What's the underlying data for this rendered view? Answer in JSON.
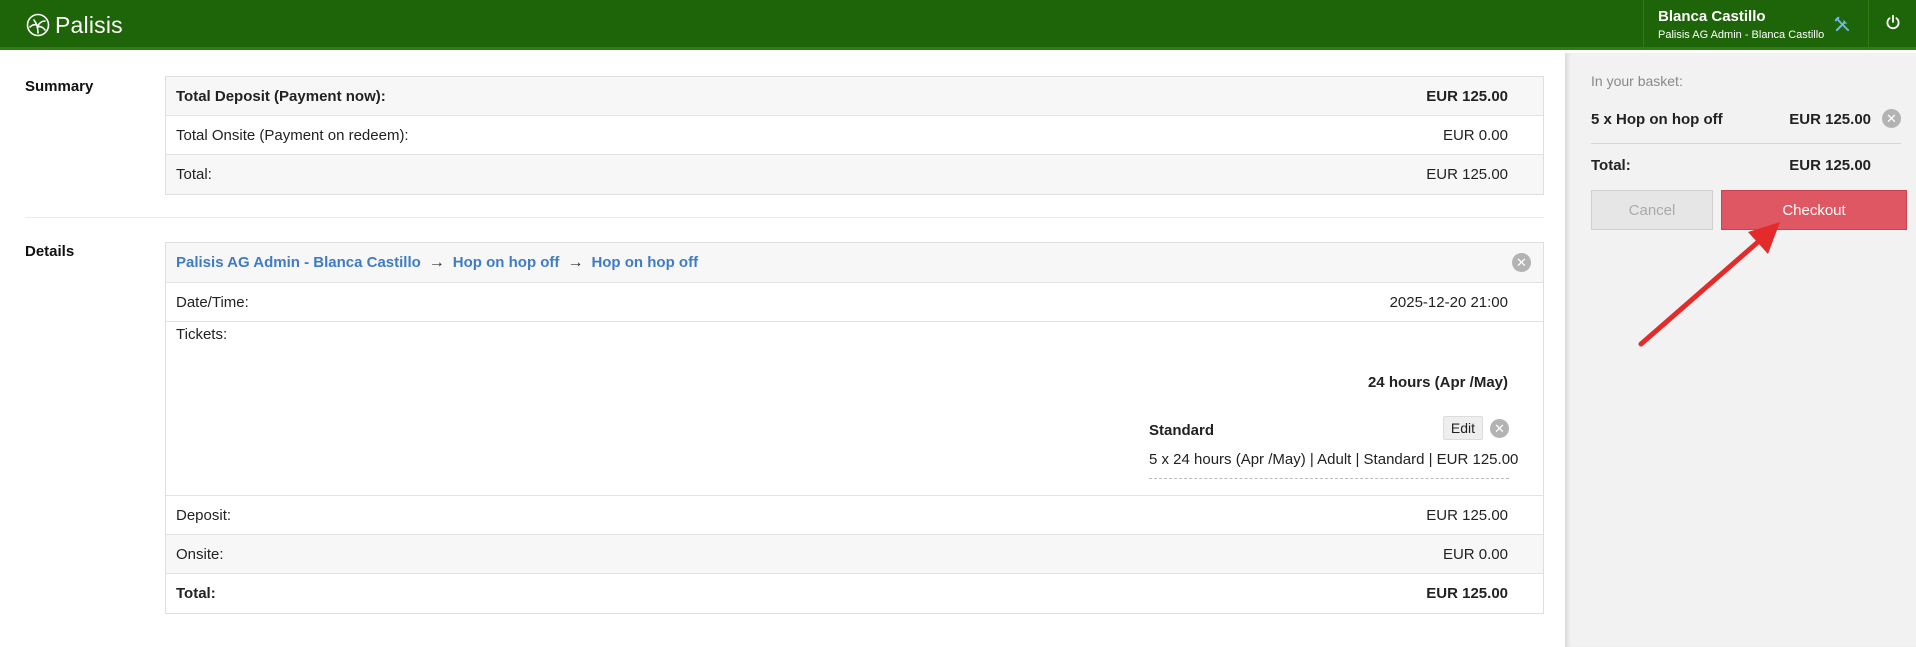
{
  "header": {
    "logo_text": "Palisis",
    "user_name": "Blanca Castillo",
    "user_org": "Palisis AG Admin - Blanca Castillo",
    "tools_icon": "tools-icon",
    "power_icon": "power-icon",
    "bar_color": "#1e6408"
  },
  "summary": {
    "label": "Summary",
    "rows": [
      {
        "label": "Total Deposit (Payment now):",
        "value": "EUR 125.00"
      },
      {
        "label": "Total Onsite (Payment on redeem):",
        "value": "EUR 0.00"
      },
      {
        "label": "Total:",
        "value": "EUR 125.00"
      }
    ]
  },
  "details": {
    "label": "Details",
    "breadcrumb": [
      "Palisis AG Admin - Blanca Castillo",
      "Hop on hop off",
      "Hop on hop off"
    ],
    "arrow": "→",
    "datetime_label": "Date/Time:",
    "datetime_value": "2025-12-20 21:00",
    "tickets_label": "Tickets:",
    "ticket_group": "24 hours (Apr /May)",
    "ticket_title": "Standard",
    "edit_label": "Edit",
    "ticket_desc": "5 x 24 hours (Apr /May) | Adult | Standard | EUR 125.00",
    "deposit_label": "Deposit:",
    "deposit_value": "EUR 125.00",
    "onsite_label": "Onsite:",
    "onsite_value": "EUR 0.00",
    "total_label": "Total:",
    "total_value": "EUR 125.00"
  },
  "basket": {
    "title": "In your basket:",
    "item_name": "5 x Hop on hop off",
    "item_price": "EUR 125.00",
    "total_label": "Total:",
    "total_value": "EUR 125.00",
    "cancel_label": "Cancel",
    "checkout_label": "Checkout",
    "checkout_color": "#e05764"
  },
  "annotation": {
    "arrow_color": "#e32b2b"
  }
}
